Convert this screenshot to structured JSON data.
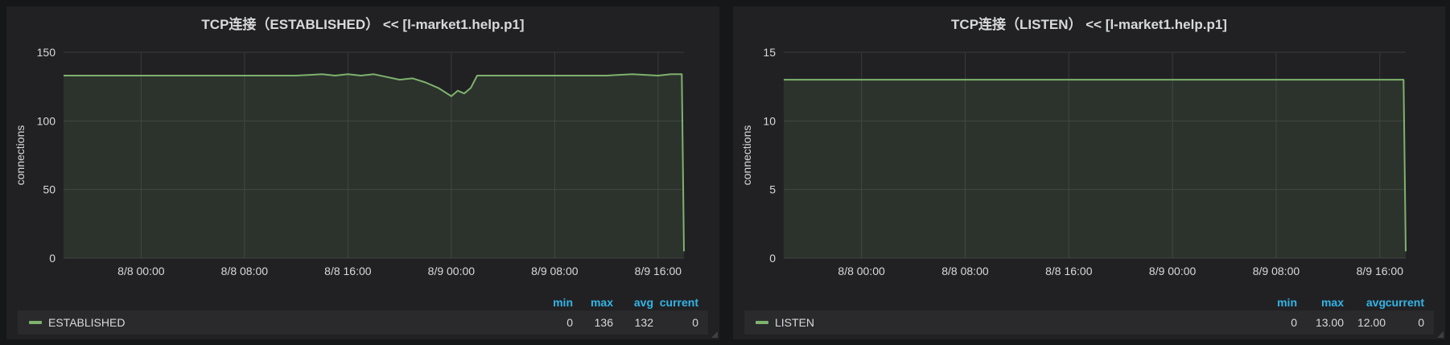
{
  "panels": [
    {
      "title": "TCP连接（ESTABLISHED） << [l-market1.help.p1]",
      "legend": {
        "headers": [
          "min",
          "max",
          "avg",
          "current"
        ],
        "series": [
          {
            "name": "ESTABLISHED",
            "color": "#7eb26d",
            "min": "0",
            "max": "136",
            "avg": "132",
            "current": "0"
          }
        ]
      }
    },
    {
      "title": "TCP连接（LISTEN） << [l-market1.help.p1]",
      "legend": {
        "headers": [
          "min",
          "max",
          "avg",
          "current"
        ],
        "series": [
          {
            "name": "LISTEN",
            "color": "#7eb26d",
            "min": "0",
            "max": "13.00",
            "avg": "12.00",
            "current": "0"
          }
        ]
      }
    }
  ],
  "chart_data": [
    {
      "type": "line",
      "title": "TCP连接（ESTABLISHED） << [l-market1.help.p1]",
      "xlabel": "",
      "ylabel": "connections",
      "ylim": [
        0,
        150
      ],
      "yticks": [
        0,
        50,
        100,
        150
      ],
      "xlim": [
        "8/7 18:00",
        "8/9 18:00"
      ],
      "xticks": [
        "8/8 00:00",
        "8/8 08:00",
        "8/8 16:00",
        "8/9 00:00",
        "8/9 08:00",
        "8/9 16:00"
      ],
      "grid": true,
      "legend": "bottom",
      "series": [
        {
          "name": "ESTABLISHED",
          "color": "#7eb26d",
          "x": [
            "8/7 18:00",
            "8/8 00:00",
            "8/8 04:00",
            "8/8 08:00",
            "8/8 12:00",
            "8/8 14:00",
            "8/8 15:00",
            "8/8 16:00",
            "8/8 17:00",
            "8/8 18:00",
            "8/8 19:00",
            "8/8 20:00",
            "8/8 21:00",
            "8/8 22:00",
            "8/8 23:00",
            "8/9 00:00",
            "8/9 00:30",
            "8/9 01:00",
            "8/9 01:30",
            "8/9 02:00",
            "8/9 04:00",
            "8/9 08:00",
            "8/9 10:00",
            "8/9 12:00",
            "8/9 14:00",
            "8/9 16:00",
            "8/9 17:00",
            "8/9 17:50",
            "8/9 18:00"
          ],
          "y": [
            133,
            133,
            133,
            133,
            133,
            134,
            133,
            134,
            133,
            134,
            132,
            130,
            131,
            128,
            124,
            118,
            122,
            120,
            124,
            133,
            133,
            133,
            133,
            133,
            134,
            133,
            134,
            134,
            5
          ]
        }
      ]
    },
    {
      "type": "line",
      "title": "TCP连接（LISTEN） << [l-market1.help.p1]",
      "xlabel": "",
      "ylabel": "connections",
      "ylim": [
        0,
        15
      ],
      "yticks": [
        0,
        5,
        10,
        15
      ],
      "xlim": [
        "8/7 18:00",
        "8/9 18:00"
      ],
      "xticks": [
        "8/8 00:00",
        "8/8 08:00",
        "8/8 16:00",
        "8/9 00:00",
        "8/9 08:00",
        "8/9 16:00"
      ],
      "grid": true,
      "legend": "bottom",
      "series": [
        {
          "name": "LISTEN",
          "color": "#7eb26d",
          "x": [
            "8/7 18:00",
            "8/9 17:50",
            "8/9 18:00"
          ],
          "y": [
            13,
            13,
            0.5
          ]
        }
      ]
    }
  ]
}
